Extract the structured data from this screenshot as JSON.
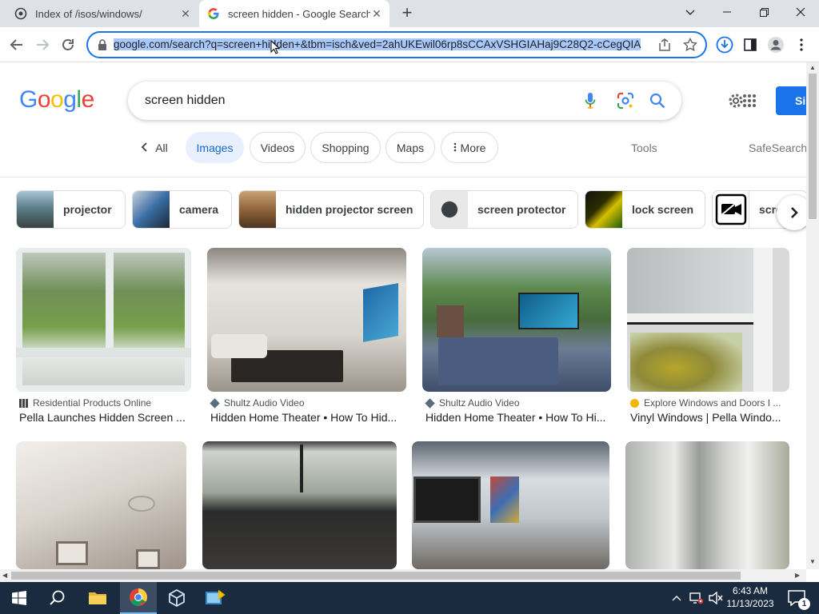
{
  "tabs": [
    {
      "title": "Index of /isos/windows/"
    },
    {
      "title": "screen hidden - Google Search"
    }
  ],
  "omnibox": {
    "url": "google.com/search?q=screen+hidden+&tbm=isch&ved=2ahUKEwil06rp8sCCAxVSHGIAHaj9C28Q2-cCegQIA"
  },
  "search": {
    "query": "screen hidden"
  },
  "header": {
    "signin": "Si"
  },
  "filters": [
    "All",
    "Images",
    "Videos",
    "Shopping",
    "Maps",
    "More"
  ],
  "tools": {
    "tools_label": "Tools",
    "safesearch_label": "SafeSearch"
  },
  "related": [
    "projector",
    "camera",
    "hidden projector screen",
    "screen protector",
    "lock screen",
    "scre"
  ],
  "results": [
    {
      "source": "Residential Products Online",
      "title": "Pella Launches Hidden Screen ..."
    },
    {
      "source": "Shultz Audio Video",
      "title": "Hidden Home Theater • How To Hid..."
    },
    {
      "source": "Shultz Audio Video",
      "title": "Hidden Home Theater • How To Hi..."
    },
    {
      "source": "Explore Windows and Doors I ...",
      "title": "Vinyl Windows | Pella Windo..."
    }
  ],
  "taskbar": {
    "time": "6:43 AM",
    "date": "11/13/2023",
    "notification_count": "1"
  },
  "colors": {
    "accent": "#1a73e8",
    "taskbar": "#1b2b3f",
    "active_chip": "#e8f0fe"
  }
}
